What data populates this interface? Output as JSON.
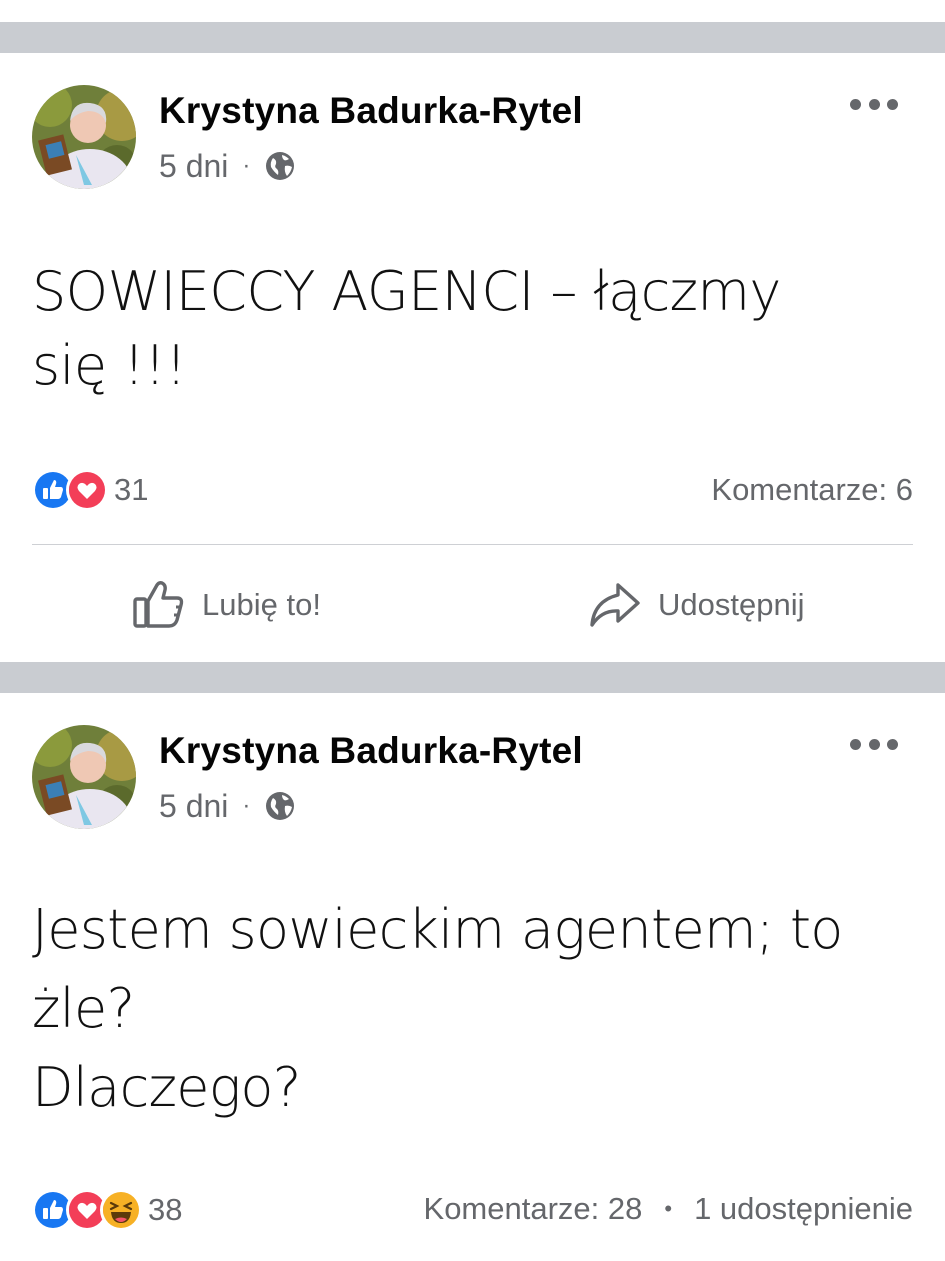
{
  "colors": {
    "separator": "#c9ccd1",
    "secondary_text": "#65676b",
    "like_blue": "#1877f2",
    "love_red": "#f33e58",
    "haha_yellow": "#f7b125"
  },
  "posts": [
    {
      "author": "Krystyna Badurka-Rytel",
      "time": "5 dni",
      "audience_icon": "globe-icon",
      "text": "SOWIECCY  AGENCI – łączmy\nsię !!!",
      "reactions": [
        "like-reaction-icon",
        "love-reaction-icon"
      ],
      "reaction_count": "31",
      "comments": "Komentarze: 6",
      "shares": "",
      "actions": {
        "like": "Lubię to!",
        "share": "Udostępnij"
      }
    },
    {
      "author": "Krystyna Badurka-Rytel",
      "time": "5 dni",
      "audience_icon": "globe-icon",
      "text": "Jestem sowieckim agentem; to\nżle?\nDlaczego?",
      "reactions": [
        "like-reaction-icon",
        "love-reaction-icon",
        "haha-reaction-icon"
      ],
      "reaction_count": "38",
      "comments": "Komentarze: 28",
      "shares": "1 udostępnienie"
    }
  ]
}
